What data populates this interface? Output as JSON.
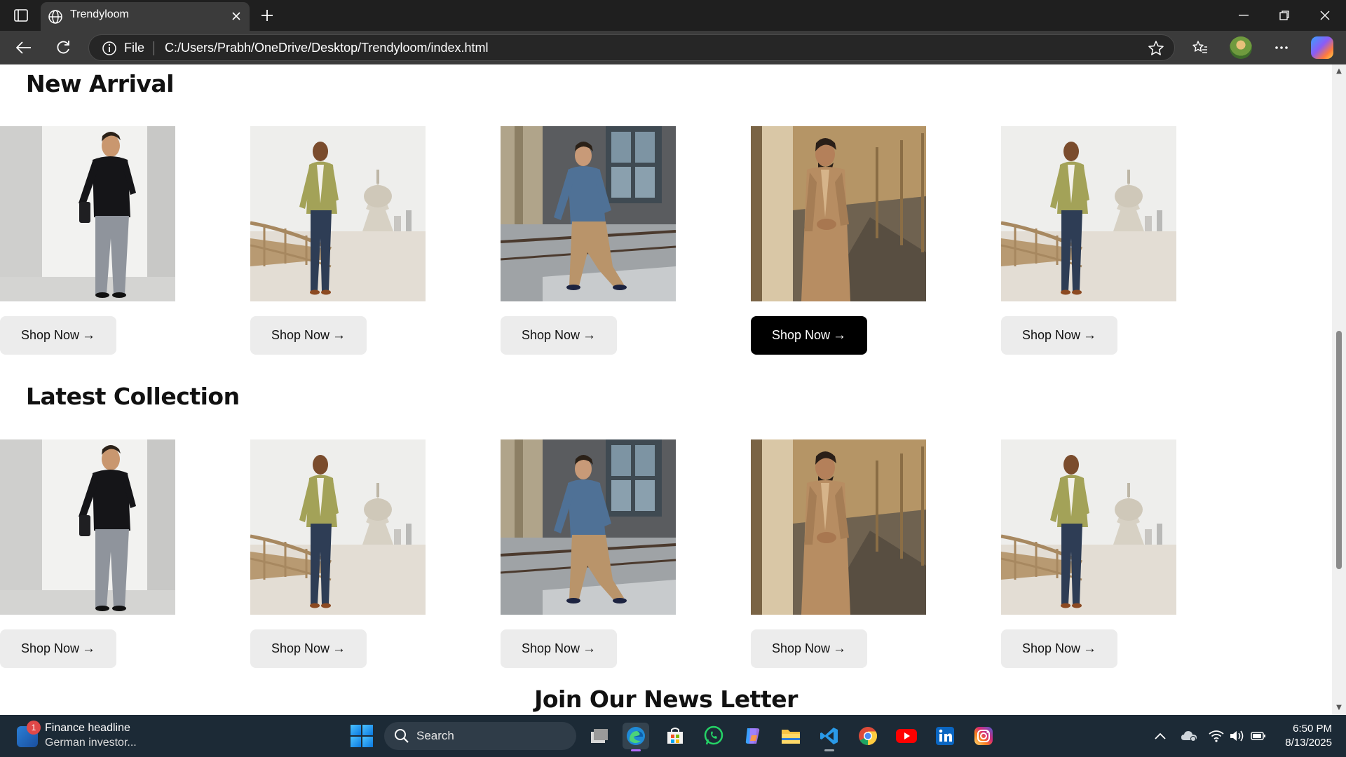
{
  "browser": {
    "tab_title": "Trendyloom",
    "address_prefix": "File",
    "url": "C:/Users/Prabh/OneDrive/Desktop/Trendyloom/index.html"
  },
  "page": {
    "sections": [
      {
        "title": "New Arrival",
        "products": [
          {
            "image": "man-black-shirt-pillar",
            "button": "Shop Now"
          },
          {
            "image": "man-olive-blazer-bridge",
            "button": "Shop Now"
          },
          {
            "image": "man-denim-shirt-railing",
            "button": "Shop Now"
          },
          {
            "image": "man-beige-kurta-corridor",
            "button": "Shop Now",
            "active": true
          },
          {
            "image": "man-olive-blazer-bridge",
            "button": "Shop Now"
          }
        ]
      },
      {
        "title": "Latest Collection",
        "products": [
          {
            "image": "man-black-shirt-pillar",
            "button": "Shop Now"
          },
          {
            "image": "man-olive-blazer-bridge",
            "button": "Shop Now"
          },
          {
            "image": "man-denim-shirt-railing",
            "button": "Shop Now"
          },
          {
            "image": "man-beige-kurta-corridor",
            "button": "Shop Now"
          },
          {
            "image": "man-olive-blazer-bridge",
            "button": "Shop Now"
          }
        ]
      }
    ],
    "newsletter_title": "Join Our News Letter"
  },
  "taskbar": {
    "news_badge": "1",
    "news_title": "Finance headline",
    "news_subtitle": "German investor...",
    "search_placeholder": "Search",
    "apps": [
      "task-view",
      "edge",
      "microsoft-store",
      "whatsapp",
      "copilot",
      "file-explorer",
      "vs-code",
      "chrome",
      "youtube",
      "linkedin",
      "instagram"
    ],
    "time": "6:50 PM",
    "date": "8/13/2025"
  },
  "colors": {
    "button_default_bg": "#ececec",
    "button_active_bg": "#000000",
    "taskbar_bg": "#1c2a36",
    "chrome_bg": "#3b3b3b"
  }
}
